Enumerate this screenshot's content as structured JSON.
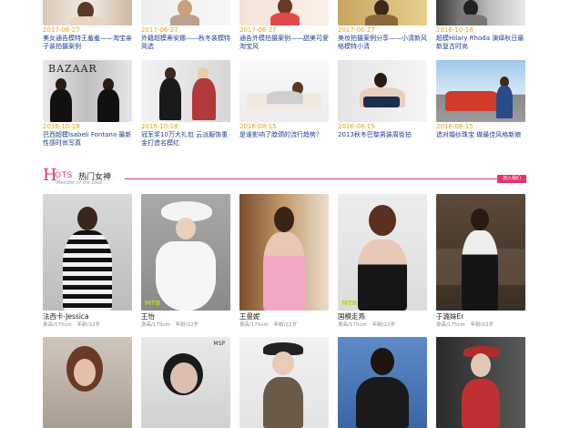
{
  "top_row": [
    {
      "date": "2017-06-27",
      "title": "美女通告模特王羞羞——淘宝亲子装拍摄案例"
    },
    {
      "date": "2017-06-27",
      "title": "外籍超模蒂安娜——秋冬装模特简选"
    },
    {
      "date": "2017-06-27",
      "title": "通告外模拍摄案例——甜美可爱淘宝风"
    },
    {
      "date": "2017-06-27",
      "title": "美妆拍摄案例分享——小清新风格模特小清"
    },
    {
      "date": "2016-10-18",
      "title": "超模Hilary Rhoda 演绎秋日最新复古时尚"
    }
  ],
  "second_row": [
    {
      "date": "2016-10-18",
      "title": "巴西超模Isabeli Fontana 最新性感时尚写真"
    },
    {
      "date": "2016-10-18",
      "title": "冠军奖10万大礼包 云派服饰重金打造名模红"
    },
    {
      "date": "2016-08-15",
      "title": "是谁影响了脖颈的流行趋势？"
    },
    {
      "date": "2016-08-15",
      "title": "2013秋冬巴黎男装周街拍"
    },
    {
      "date": "2016-08-15",
      "title": "选对婚纱珠宝 做最佳风格新娘"
    }
  ],
  "section": {
    "letter": "H",
    "title_rest": "OTS",
    "title_cn": "热门女神",
    "subtitle": "Member of the zone",
    "join_label": "加入我们"
  },
  "members": [
    {
      "name": "法西卡-Jessica",
      "height": "身高/175cm",
      "weight": "年龄/22岁"
    },
    {
      "name": "王怡",
      "height": "身高/175cm",
      "weight": "年龄/22岁"
    },
    {
      "name": "王曼妮",
      "height": "身高/175cm",
      "weight": "年龄/22岁"
    },
    {
      "name": "国模走燕",
      "height": "身高/175cm",
      "weight": "年龄/22岁"
    },
    {
      "name": "于潞妹Er",
      "height": "身高/175cm",
      "weight": "年龄/22岁"
    }
  ],
  "badges": [
    "MTB"
  ],
  "colors": {
    "accent": "#e5336d",
    "date": "#e6a21a",
    "link": "#1e3d8f"
  }
}
